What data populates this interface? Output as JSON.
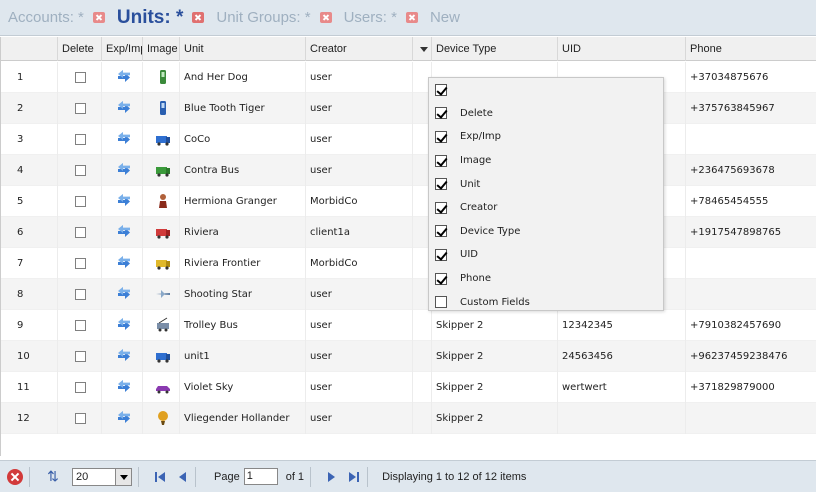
{
  "tabs": [
    {
      "label": "Accounts: *",
      "closable": true,
      "active": false
    },
    {
      "label": "Units: *",
      "closable": true,
      "active": true
    },
    {
      "label": "Unit Groups: *",
      "closable": true,
      "active": false
    },
    {
      "label": "Users: *",
      "closable": true,
      "active": false
    },
    {
      "label": "New",
      "closable": false,
      "active": false
    }
  ],
  "grid": {
    "columns": {
      "num": "",
      "delete": "Delete",
      "exp_imp": "Exp/Imp",
      "image": "Image",
      "unit": "Unit",
      "creator": "Creator",
      "device_type": "Device Type",
      "uid": "UID",
      "phone": "Phone"
    },
    "rows": [
      {
        "num": "1",
        "unit": "And Her Dog",
        "creator": "user",
        "device_type": "",
        "uid": "",
        "phone": "+37034875676",
        "icon": "green-phone-icon"
      },
      {
        "num": "2",
        "unit": "Blue Tooth Tiger",
        "creator": "user",
        "device_type": "",
        "uid": "",
        "phone": "+375763845967",
        "icon": "blue-phone-icon"
      },
      {
        "num": "3",
        "unit": "CoCo",
        "creator": "user",
        "device_type": "",
        "uid": "",
        "phone": "",
        "icon": "blue-truck-icon"
      },
      {
        "num": "4",
        "unit": "Contra Bus",
        "creator": "user",
        "device_type": "",
        "uid": "",
        "phone": "+236475693678",
        "icon": "green-truck-icon"
      },
      {
        "num": "5",
        "unit": "Hermiona Granger",
        "creator": "MorbidCo",
        "device_type": "",
        "uid": "",
        "phone": "+78465454555",
        "icon": "person-icon"
      },
      {
        "num": "6",
        "unit": "Riviera",
        "creator": "client1a",
        "device_type": "",
        "uid": "",
        "phone": "+1917547898765",
        "icon": "red-truck-icon"
      },
      {
        "num": "7",
        "unit": "Riviera Frontier",
        "creator": "MorbidCo",
        "device_type": "",
        "uid": "",
        "phone": "",
        "icon": "yellow-truck-icon"
      },
      {
        "num": "8",
        "unit": "Shooting Star",
        "creator": "user",
        "device_type": "",
        "uid": "",
        "phone": "",
        "icon": "plane-icon"
      },
      {
        "num": "9",
        "unit": "Trolley Bus",
        "creator": "user",
        "device_type": "Skipper 2",
        "uid": "12342345",
        "phone": "+7910382457690",
        "icon": "trolley-icon"
      },
      {
        "num": "10",
        "unit": "unit1",
        "creator": "user",
        "device_type": "Skipper 2",
        "uid": "24563456",
        "phone": "+96237459238476",
        "icon": "blue-truck-icon"
      },
      {
        "num": "11",
        "unit": "Violet Sky",
        "creator": "user",
        "device_type": "Skipper 2",
        "uid": "wertwert",
        "phone": "+371829879000",
        "icon": "purple-car-icon"
      },
      {
        "num": "12",
        "unit": "Vliegender Hollander",
        "creator": "user",
        "device_type": "Skipper 2",
        "uid": "",
        "phone": "",
        "icon": "balloon-icon"
      }
    ],
    "overlay_text_row8": "Skipper 2"
  },
  "column_menu": {
    "items": [
      {
        "label": "",
        "checked": true
      },
      {
        "label": "Delete",
        "checked": true
      },
      {
        "label": "Exp/Imp",
        "checked": true
      },
      {
        "label": "Image",
        "checked": true
      },
      {
        "label": "Unit",
        "checked": true
      },
      {
        "label": "Creator",
        "checked": true
      },
      {
        "label": "Device Type",
        "checked": true
      },
      {
        "label": "UID",
        "checked": true
      },
      {
        "label": "Phone",
        "checked": true
      },
      {
        "label": "Custom Fields",
        "checked": false
      }
    ]
  },
  "toolbar": {
    "page_size": "20",
    "page_label": "Page",
    "page_value": "1",
    "of_label": "of 1",
    "display_text": "Displaying 1 to 12 of 12 items"
  },
  "colors": {
    "tab_active": "#2a4f9c",
    "tab_inactive": "#9fb0c0",
    "toolbar_bg": "#dfe7ee",
    "nav_blue": "#3c64b4",
    "delete_red": "#d23a3a"
  }
}
